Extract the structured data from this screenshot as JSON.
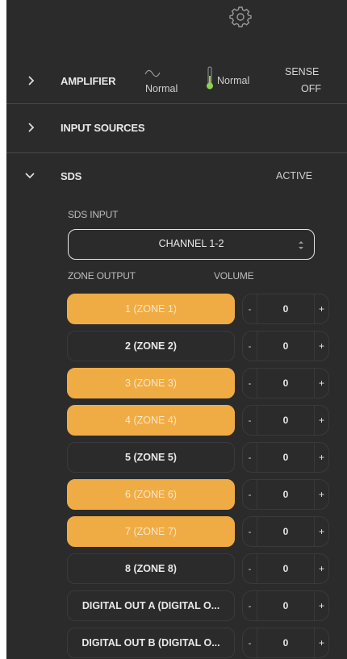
{
  "header": {
    "settings_icon": "gear-icon"
  },
  "amplifier": {
    "title": "AMPLIFIER",
    "signal_icon": "wave-icon",
    "signal_status": "Normal",
    "temp_icon": "thermometer-icon",
    "temp_status": "Normal",
    "sense_label": "SENSE",
    "sense_value": "OFF"
  },
  "input_sources": {
    "title": "INPUT SOURCES"
  },
  "sds": {
    "title": "SDS",
    "status": "ACTIVE",
    "input_label": "SDS INPUT",
    "input_value": "CHANNEL 1-2",
    "zone_output_header": "ZONE OUTPUT",
    "volume_header": "VOLUME",
    "zones": [
      {
        "label": "1 (ZONE 1)",
        "active": true,
        "volume": "0",
        "minus": "-",
        "plus": "+"
      },
      {
        "label": "2 (ZONE 2)",
        "active": false,
        "volume": "0",
        "minus": "-",
        "plus": "+"
      },
      {
        "label": "3 (ZONE 3)",
        "active": true,
        "volume": "0",
        "minus": "-",
        "plus": "+"
      },
      {
        "label": "4 (ZONE 4)",
        "active": true,
        "volume": "0",
        "minus": "-",
        "plus": "+"
      },
      {
        "label": "5 (ZONE 5)",
        "active": false,
        "volume": "0",
        "minus": "-",
        "plus": "+"
      },
      {
        "label": "6 (ZONE 6)",
        "active": true,
        "volume": "0",
        "minus": "-",
        "plus": "+"
      },
      {
        "label": "7 (ZONE 7)",
        "active": true,
        "volume": "0",
        "minus": "-",
        "plus": "+"
      },
      {
        "label": "8 (ZONE 8)",
        "active": false,
        "volume": "0",
        "minus": "-",
        "plus": "+"
      },
      {
        "label": "DIGITAL OUT A (DIGITAL O...",
        "active": false,
        "volume": "0",
        "minus": "-",
        "plus": "+"
      },
      {
        "label": "DIGITAL OUT B (DIGITAL O...",
        "active": false,
        "volume": "0",
        "minus": "-",
        "plus": "+"
      }
    ]
  },
  "colors": {
    "panel_bg": "#2b2b2b",
    "accent_active": "#f0ac44",
    "thermometer": "#8fd14f"
  }
}
